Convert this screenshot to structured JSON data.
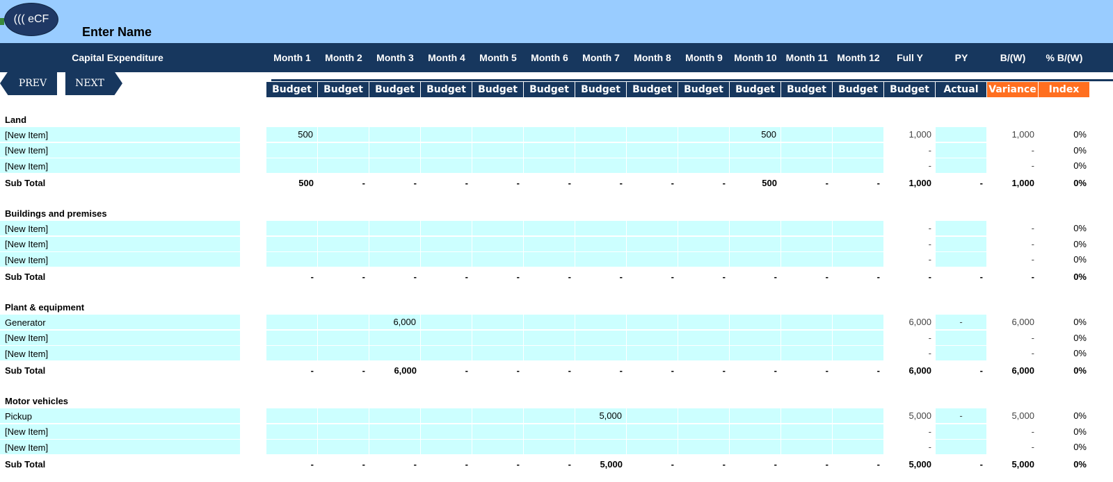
{
  "app": {
    "logo_text": "((( eCF",
    "name_placeholder": "Enter Name"
  },
  "nav": {
    "prev": "PREV",
    "next": "NEXT"
  },
  "header": {
    "title": "Capital Expenditure",
    "columns": [
      "Month 1",
      "Month 2",
      "Month 3",
      "Month 4",
      "Month 5",
      "Month 6",
      "Month 7",
      "Month 8",
      "Month 9",
      "Month 10",
      "Month 11",
      "Month 12",
      "Full Y",
      "PY",
      "B/(W)",
      "% B/(W)"
    ],
    "subheaders": [
      "Budget",
      "Budget",
      "Budget",
      "Budget",
      "Budget",
      "Budget",
      "Budget",
      "Budget",
      "Budget",
      "Budget",
      "Budget",
      "Budget",
      "Budget",
      "Actual",
      "Variance",
      "Index"
    ]
  },
  "sections": [
    {
      "title": "Land",
      "items": [
        {
          "label": "[New Item]",
          "months": [
            "500",
            "",
            "",
            "",
            "",
            "",
            "",
            "",
            "",
            "500",
            "",
            ""
          ],
          "full_y": "1,000",
          "py": "",
          "bw": "1,000",
          "pct": "0%"
        },
        {
          "label": "[New Item]",
          "months": [
            "",
            "",
            "",
            "",
            "",
            "",
            "",
            "",
            "",
            "",
            "",
            ""
          ],
          "full_y": "-",
          "py": "",
          "bw": "-",
          "pct": "0%"
        },
        {
          "label": "[New Item]",
          "months": [
            "",
            "",
            "",
            "",
            "",
            "",
            "",
            "",
            "",
            "",
            "",
            ""
          ],
          "full_y": "-",
          "py": "",
          "bw": "-",
          "pct": "0%"
        }
      ],
      "subtotal": {
        "label": "Sub Total",
        "months": [
          "500",
          "-",
          "-",
          "-",
          "-",
          "-",
          "-",
          "-",
          "-",
          "500",
          "-",
          "-"
        ],
        "full_y": "1,000",
        "py": "-",
        "bw": "1,000",
        "pct": "0%"
      }
    },
    {
      "title": "Buildings and premises",
      "items": [
        {
          "label": "[New Item]",
          "months": [
            "",
            "",
            "",
            "",
            "",
            "",
            "",
            "",
            "",
            "",
            "",
            ""
          ],
          "full_y": "-",
          "py": "",
          "bw": "-",
          "pct": "0%"
        },
        {
          "label": "[New Item]",
          "months": [
            "",
            "",
            "",
            "",
            "",
            "",
            "",
            "",
            "",
            "",
            "",
            ""
          ],
          "full_y": "-",
          "py": "",
          "bw": "-",
          "pct": "0%"
        },
        {
          "label": "[New Item]",
          "months": [
            "",
            "",
            "",
            "",
            "",
            "",
            "",
            "",
            "",
            "",
            "",
            ""
          ],
          "full_y": "-",
          "py": "",
          "bw": "-",
          "pct": "0%"
        }
      ],
      "subtotal": {
        "label": "Sub Total",
        "months": [
          "-",
          "-",
          "-",
          "-",
          "-",
          "-",
          "-",
          "-",
          "-",
          "-",
          "-",
          "-"
        ],
        "full_y": "-",
        "py": "-",
        "bw": "-",
        "pct": "0%"
      }
    },
    {
      "title": "Plant & equipment",
      "items": [
        {
          "label": "Generator",
          "months": [
            "",
            "",
            "6,000",
            "",
            "",
            "",
            "",
            "",
            "",
            "",
            "",
            ""
          ],
          "full_y": "6,000",
          "py": "-",
          "bw": "6,000",
          "pct": "0%"
        },
        {
          "label": "[New Item]",
          "months": [
            "",
            "",
            "",
            "",
            "",
            "",
            "",
            "",
            "",
            "",
            "",
            ""
          ],
          "full_y": "-",
          "py": "",
          "bw": "-",
          "pct": "0%"
        },
        {
          "label": "[New Item]",
          "months": [
            "",
            "",
            "",
            "",
            "",
            "",
            "",
            "",
            "",
            "",
            "",
            ""
          ],
          "full_y": "-",
          "py": "",
          "bw": "-",
          "pct": "0%"
        }
      ],
      "subtotal": {
        "label": "Sub Total",
        "months": [
          "-",
          "-",
          "6,000",
          "-",
          "-",
          "-",
          "-",
          "-",
          "-",
          "-",
          "-",
          "-"
        ],
        "full_y": "6,000",
        "py": "-",
        "bw": "6,000",
        "pct": "0%"
      }
    },
    {
      "title": "Motor vehicles",
      "items": [
        {
          "label": "Pickup",
          "months": [
            "",
            "",
            "",
            "",
            "",
            "",
            "5,000",
            "",
            "",
            "",
            "",
            ""
          ],
          "full_y": "5,000",
          "py": "-",
          "bw": "5,000",
          "pct": "0%"
        },
        {
          "label": "[New Item]",
          "months": [
            "",
            "",
            "",
            "",
            "",
            "",
            "",
            "",
            "",
            "",
            "",
            ""
          ],
          "full_y": "-",
          "py": "",
          "bw": "-",
          "pct": "0%"
        },
        {
          "label": "[New Item]",
          "months": [
            "",
            "",
            "",
            "",
            "",
            "",
            "",
            "",
            "",
            "",
            "",
            ""
          ],
          "full_y": "-",
          "py": "",
          "bw": "-",
          "pct": "0%"
        }
      ],
      "subtotal": {
        "label": "Sub Total",
        "months": [
          "-",
          "-",
          "-",
          "-",
          "-",
          "-",
          "5,000",
          "-",
          "-",
          "-",
          "-",
          "-"
        ],
        "full_y": "5,000",
        "py": "-",
        "bw": "5,000",
        "pct": "0%"
      }
    }
  ],
  "colors": {
    "header_bg": "#17375e",
    "top_bg": "#99ccff",
    "input_bg": "#ccffff",
    "accent_orange": "#ff6f20"
  }
}
